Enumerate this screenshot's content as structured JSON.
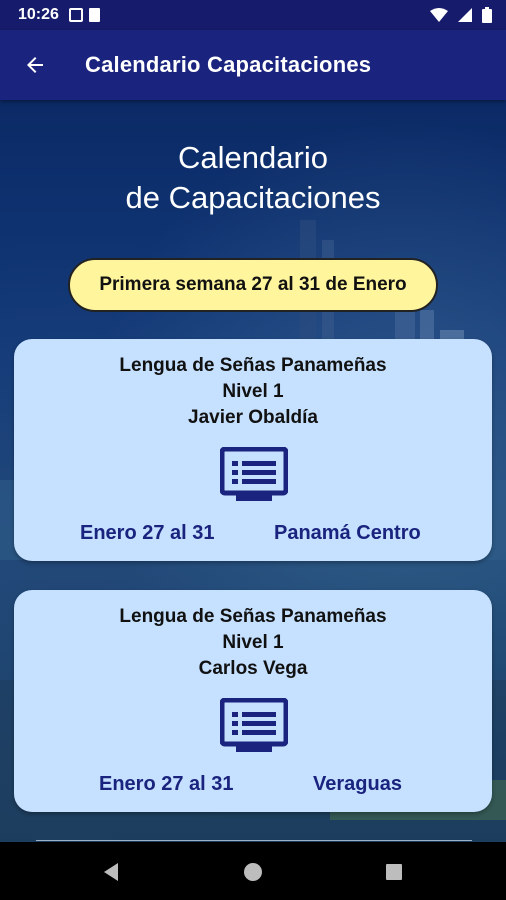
{
  "status_bar": {
    "time": "10:26"
  },
  "app_bar": {
    "title": "Calendario Capacitaciones"
  },
  "heading": {
    "line1": "Calendario",
    "line2": "de Capacitaciones"
  },
  "week_label": "Primera semana 27 al 31 de Enero",
  "cards": [
    {
      "course": "Lengua de Señas Panameñas",
      "level": "Nivel 1",
      "instructor": "Javier Obaldía",
      "dates": "Enero 27 al 31",
      "location": "Panamá Centro"
    },
    {
      "course": "Lengua de Señas Panameñas",
      "level": "Nivel 1",
      "instructor": "Carlos Vega",
      "dates": "Enero 27 al 31",
      "location": "Veraguas"
    }
  ],
  "colors": {
    "app_bar": "#1a237e",
    "card_bg": "#c5e1ff",
    "pill_bg": "#fff59d",
    "accent_text": "#1a237e"
  },
  "icons": [
    "back-arrow-icon",
    "presentation-screen-icon",
    "nav-back-icon",
    "nav-home-icon",
    "nav-recents-icon"
  ]
}
